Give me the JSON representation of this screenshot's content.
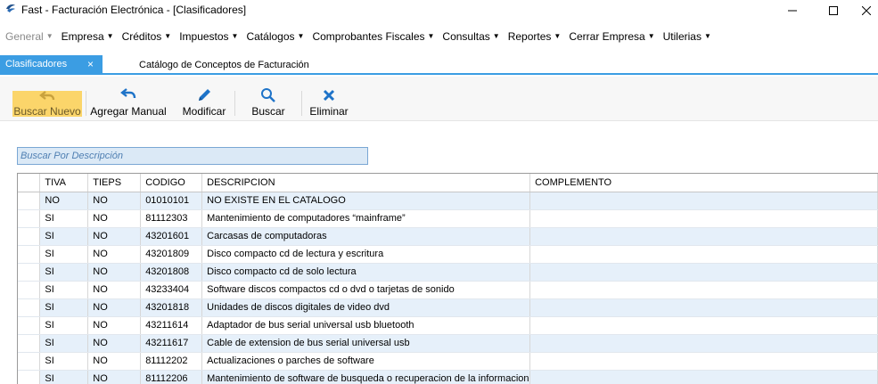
{
  "window": {
    "title": "Fast - Facturación Electrónica - [Clasificadores]",
    "icon": "fast-app-icon",
    "icon_caption": "FAST"
  },
  "menu": [
    {
      "label": "General",
      "enabled": false
    },
    {
      "label": "Empresa",
      "enabled": true
    },
    {
      "label": "Créditos",
      "enabled": true
    },
    {
      "label": "Impuestos",
      "enabled": true
    },
    {
      "label": "Catálogos",
      "enabled": true
    },
    {
      "label": "Comprobantes Fiscales",
      "enabled": true
    },
    {
      "label": "Consultas",
      "enabled": true
    },
    {
      "label": "Reportes",
      "enabled": true
    },
    {
      "label": "Cerrar Empresa",
      "enabled": true
    },
    {
      "label": "Utilerias",
      "enabled": true
    }
  ],
  "tabs": {
    "active_label": "Clasificadores",
    "close_glyph": "×",
    "page_title": "Catálogo de Conceptos de Facturación"
  },
  "toolbar": {
    "buscar_nuevo": "Buscar Nuevo",
    "agregar_manual": "Agregar Manual",
    "modificar": "Modificar",
    "buscar": "Buscar",
    "eliminar": "Eliminar"
  },
  "search": {
    "placeholder": "Buscar Por Descripción"
  },
  "colors": {
    "accent": "#3b9de3",
    "highlight": "#fbd56a",
    "row_alt": "#e6f0fa",
    "icon_blue": "#1e73c8"
  },
  "grid": {
    "headers": [
      "TIVA",
      "TIEPS",
      "CODIGO",
      "DESCRIPCION",
      "COMPLEMENTO"
    ],
    "rows": [
      [
        "NO",
        "NO",
        "01010101",
        "NO EXISTE EN EL CATALOGO",
        ""
      ],
      [
        "SI",
        "NO",
        "81112303",
        "Mantenimiento de computadores “mainframe”",
        ""
      ],
      [
        "SI",
        "NO",
        "43201601",
        "Carcasas de computadoras",
        ""
      ],
      [
        "SI",
        "NO",
        "43201809",
        "Disco compacto cd de lectura y escritura",
        ""
      ],
      [
        "SI",
        "NO",
        "43201808",
        "Disco compacto cd de solo lectura",
        ""
      ],
      [
        "SI",
        "NO",
        "43233404",
        "Software discos compactos cd o dvd o tarjetas de sonido",
        ""
      ],
      [
        "SI",
        "NO",
        "43201818",
        "Unidades de discos digitales de video dvd",
        ""
      ],
      [
        "SI",
        "NO",
        "43211614",
        "Adaptador de bus serial universal usb bluetooth",
        ""
      ],
      [
        "SI",
        "NO",
        "43211617",
        "Cable de extension de bus serial universal usb",
        ""
      ],
      [
        "SI",
        "NO",
        "81112202",
        "Actualizaciones o parches de software",
        ""
      ],
      [
        "SI",
        "NO",
        "81112206",
        "Mantenimiento de software de busqueda o recuperacion de la informacion",
        ""
      ]
    ]
  }
}
